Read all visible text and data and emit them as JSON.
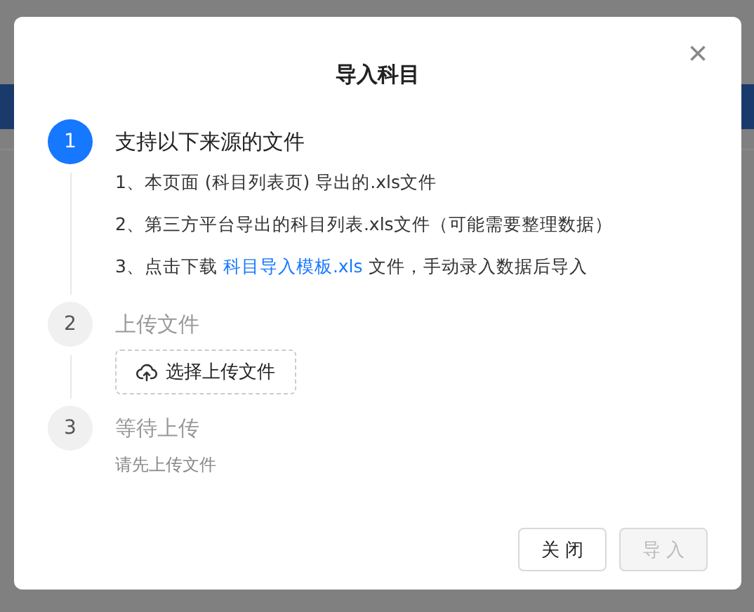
{
  "dialog": {
    "title": "导入科目",
    "close_icon": "×"
  },
  "steps": [
    {
      "number": "1",
      "title": "支持以下来源的文件",
      "active": true,
      "items": [
        [
          {
            "kind": "text",
            "text": "1、本页面 (科目列表页) 导出的.xls文件"
          }
        ],
        [
          {
            "kind": "text",
            "text": "2、第三方平台导出的科目列表.xls文件（可能需要整理数据）"
          }
        ],
        [
          {
            "kind": "text",
            "text": "3、点击下载 "
          },
          {
            "kind": "link",
            "text": "科目导入模板.xls"
          },
          {
            "kind": "text",
            "text": " 文件，手动录入数据后导入"
          }
        ]
      ]
    },
    {
      "number": "2",
      "title": "上传文件",
      "active": false,
      "upload_button": "选择上传文件"
    },
    {
      "number": "3",
      "title": "等待上传",
      "active": false,
      "description": "请先上传文件"
    }
  ],
  "buttons": [
    {
      "label": "关 闭",
      "disabled": false
    },
    {
      "label": "导 入",
      "disabled": true
    }
  ]
}
